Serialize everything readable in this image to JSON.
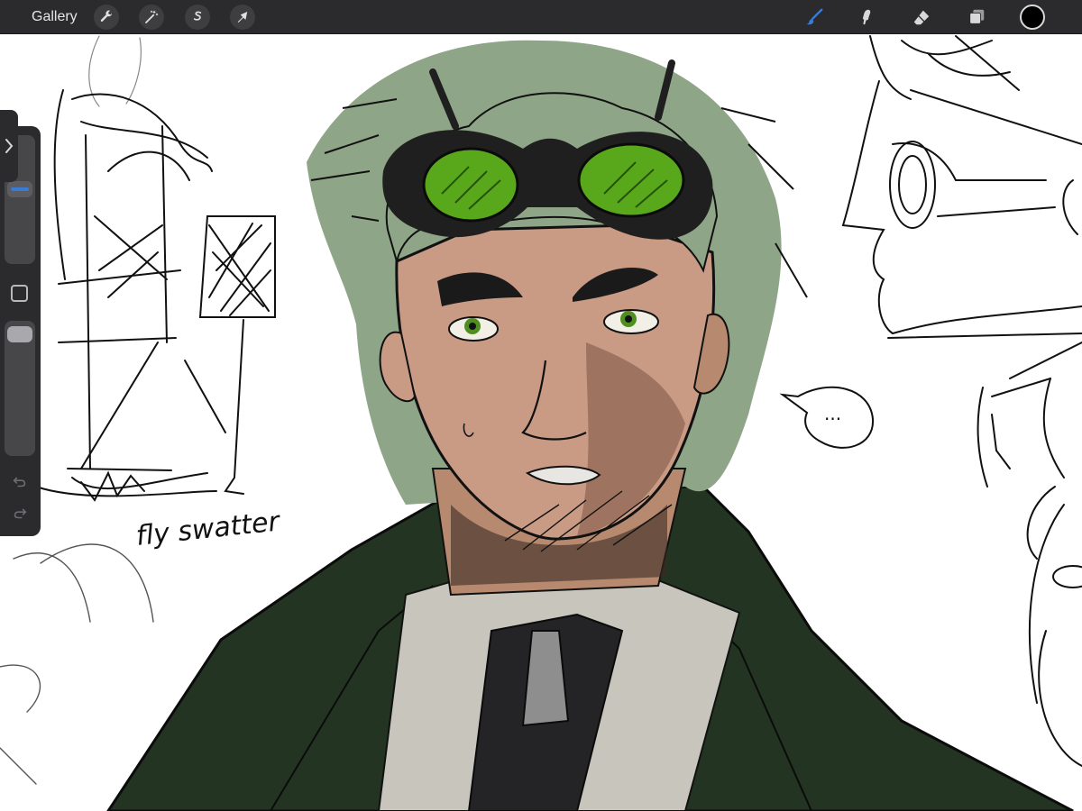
{
  "app": {
    "name": "Procreate",
    "accent_color": "#3a7bd5"
  },
  "toolbar": {
    "gallery_label": "Gallery",
    "left_tools": [
      {
        "name": "actions",
        "icon": "wrench-icon"
      },
      {
        "name": "adjustments",
        "icon": "magic-wand-icon"
      },
      {
        "name": "selection",
        "icon": "selection-s-icon"
      },
      {
        "name": "transform",
        "icon": "arrow-cursor-icon"
      }
    ],
    "right_tools": [
      {
        "name": "brush",
        "icon": "brush-icon",
        "active": true
      },
      {
        "name": "smudge",
        "icon": "smudge-icon",
        "active": false
      },
      {
        "name": "eraser",
        "icon": "eraser-icon",
        "active": false
      },
      {
        "name": "layers",
        "icon": "layers-icon",
        "active": false
      }
    ],
    "current_color": "#000000"
  },
  "sidebar": {
    "brush_size_level": 0.6,
    "opacity_level": 0.98
  },
  "canvas": {
    "handwritten_note": "fly swatter",
    "speech_bubble_text": "..."
  }
}
